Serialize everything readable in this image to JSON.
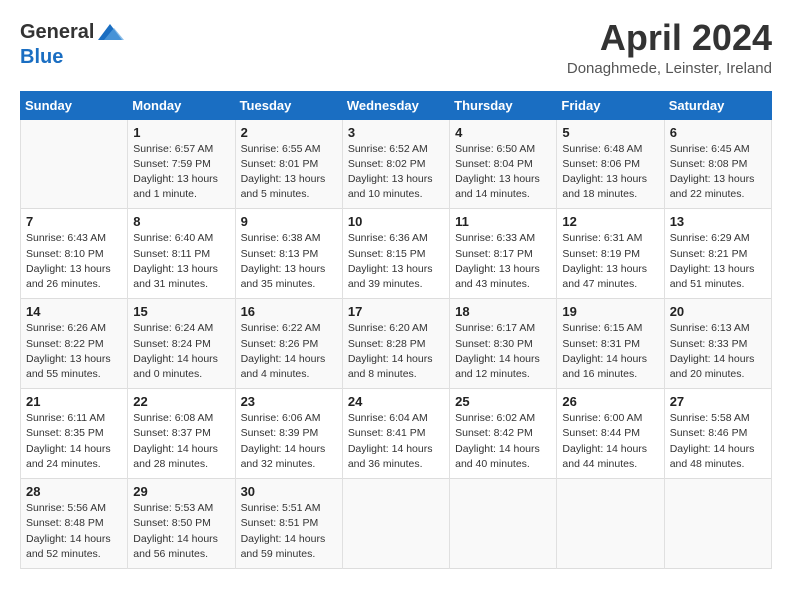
{
  "header": {
    "logo_general": "General",
    "logo_blue": "Blue",
    "month_title": "April 2024",
    "location": "Donaghmede, Leinster, Ireland"
  },
  "days_of_week": [
    "Sunday",
    "Monday",
    "Tuesday",
    "Wednesday",
    "Thursday",
    "Friday",
    "Saturday"
  ],
  "weeks": [
    [
      {
        "day": "",
        "info": ""
      },
      {
        "day": "1",
        "info": "Sunrise: 6:57 AM\nSunset: 7:59 PM\nDaylight: 13 hours\nand 1 minute."
      },
      {
        "day": "2",
        "info": "Sunrise: 6:55 AM\nSunset: 8:01 PM\nDaylight: 13 hours\nand 5 minutes."
      },
      {
        "day": "3",
        "info": "Sunrise: 6:52 AM\nSunset: 8:02 PM\nDaylight: 13 hours\nand 10 minutes."
      },
      {
        "day": "4",
        "info": "Sunrise: 6:50 AM\nSunset: 8:04 PM\nDaylight: 13 hours\nand 14 minutes."
      },
      {
        "day": "5",
        "info": "Sunrise: 6:48 AM\nSunset: 8:06 PM\nDaylight: 13 hours\nand 18 minutes."
      },
      {
        "day": "6",
        "info": "Sunrise: 6:45 AM\nSunset: 8:08 PM\nDaylight: 13 hours\nand 22 minutes."
      }
    ],
    [
      {
        "day": "7",
        "info": "Sunrise: 6:43 AM\nSunset: 8:10 PM\nDaylight: 13 hours\nand 26 minutes."
      },
      {
        "day": "8",
        "info": "Sunrise: 6:40 AM\nSunset: 8:11 PM\nDaylight: 13 hours\nand 31 minutes."
      },
      {
        "day": "9",
        "info": "Sunrise: 6:38 AM\nSunset: 8:13 PM\nDaylight: 13 hours\nand 35 minutes."
      },
      {
        "day": "10",
        "info": "Sunrise: 6:36 AM\nSunset: 8:15 PM\nDaylight: 13 hours\nand 39 minutes."
      },
      {
        "day": "11",
        "info": "Sunrise: 6:33 AM\nSunset: 8:17 PM\nDaylight: 13 hours\nand 43 minutes."
      },
      {
        "day": "12",
        "info": "Sunrise: 6:31 AM\nSunset: 8:19 PM\nDaylight: 13 hours\nand 47 minutes."
      },
      {
        "day": "13",
        "info": "Sunrise: 6:29 AM\nSunset: 8:21 PM\nDaylight: 13 hours\nand 51 minutes."
      }
    ],
    [
      {
        "day": "14",
        "info": "Sunrise: 6:26 AM\nSunset: 8:22 PM\nDaylight: 13 hours\nand 55 minutes."
      },
      {
        "day": "15",
        "info": "Sunrise: 6:24 AM\nSunset: 8:24 PM\nDaylight: 14 hours\nand 0 minutes."
      },
      {
        "day": "16",
        "info": "Sunrise: 6:22 AM\nSunset: 8:26 PM\nDaylight: 14 hours\nand 4 minutes."
      },
      {
        "day": "17",
        "info": "Sunrise: 6:20 AM\nSunset: 8:28 PM\nDaylight: 14 hours\nand 8 minutes."
      },
      {
        "day": "18",
        "info": "Sunrise: 6:17 AM\nSunset: 8:30 PM\nDaylight: 14 hours\nand 12 minutes."
      },
      {
        "day": "19",
        "info": "Sunrise: 6:15 AM\nSunset: 8:31 PM\nDaylight: 14 hours\nand 16 minutes."
      },
      {
        "day": "20",
        "info": "Sunrise: 6:13 AM\nSunset: 8:33 PM\nDaylight: 14 hours\nand 20 minutes."
      }
    ],
    [
      {
        "day": "21",
        "info": "Sunrise: 6:11 AM\nSunset: 8:35 PM\nDaylight: 14 hours\nand 24 minutes."
      },
      {
        "day": "22",
        "info": "Sunrise: 6:08 AM\nSunset: 8:37 PM\nDaylight: 14 hours\nand 28 minutes."
      },
      {
        "day": "23",
        "info": "Sunrise: 6:06 AM\nSunset: 8:39 PM\nDaylight: 14 hours\nand 32 minutes."
      },
      {
        "day": "24",
        "info": "Sunrise: 6:04 AM\nSunset: 8:41 PM\nDaylight: 14 hours\nand 36 minutes."
      },
      {
        "day": "25",
        "info": "Sunrise: 6:02 AM\nSunset: 8:42 PM\nDaylight: 14 hours\nand 40 minutes."
      },
      {
        "day": "26",
        "info": "Sunrise: 6:00 AM\nSunset: 8:44 PM\nDaylight: 14 hours\nand 44 minutes."
      },
      {
        "day": "27",
        "info": "Sunrise: 5:58 AM\nSunset: 8:46 PM\nDaylight: 14 hours\nand 48 minutes."
      }
    ],
    [
      {
        "day": "28",
        "info": "Sunrise: 5:56 AM\nSunset: 8:48 PM\nDaylight: 14 hours\nand 52 minutes."
      },
      {
        "day": "29",
        "info": "Sunrise: 5:53 AM\nSunset: 8:50 PM\nDaylight: 14 hours\nand 56 minutes."
      },
      {
        "day": "30",
        "info": "Sunrise: 5:51 AM\nSunset: 8:51 PM\nDaylight: 14 hours\nand 59 minutes."
      },
      {
        "day": "",
        "info": ""
      },
      {
        "day": "",
        "info": ""
      },
      {
        "day": "",
        "info": ""
      },
      {
        "day": "",
        "info": ""
      }
    ]
  ]
}
